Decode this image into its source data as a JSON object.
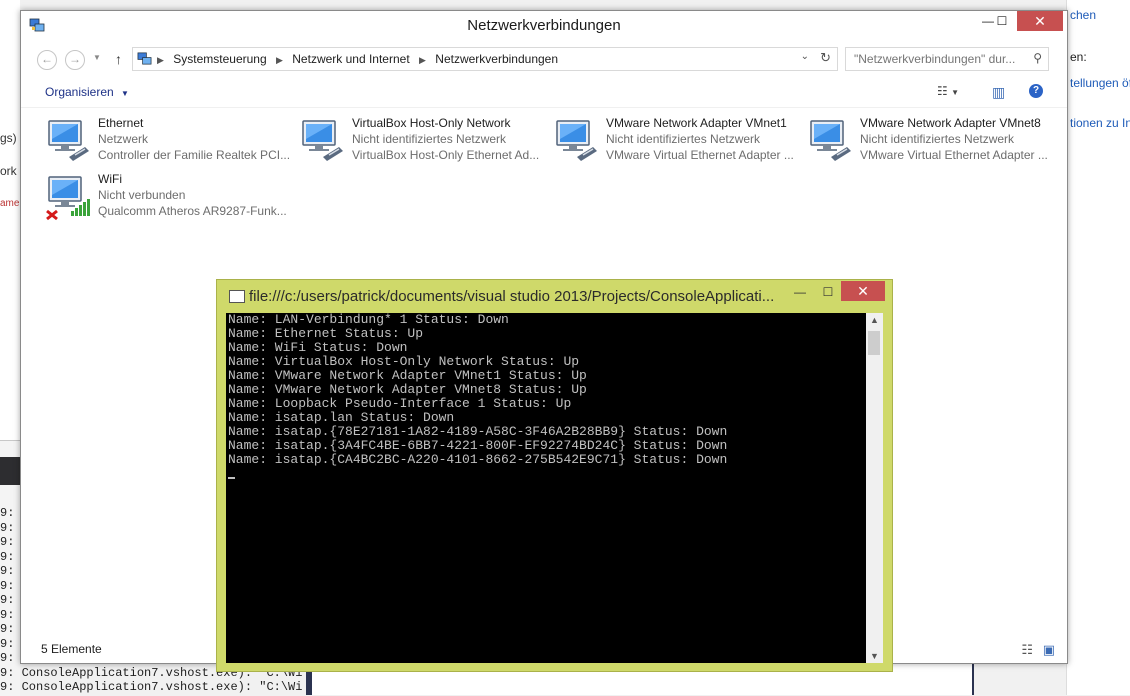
{
  "background": {
    "left_fragments": [
      "gs)",
      "ork",
      "ame"
    ],
    "right_links": [
      "chen",
      "en:",
      "tellungen öf",
      "tionen zu In"
    ],
    "console_lines": [
      "9:",
      "9:",
      "9:",
      "9:",
      "9:",
      "9:",
      "9:",
      "9:",
      "9:",
      "9:",
      "9:",
      "9: ConsoleApplication7.vshost.exe): \"C:\\Wi",
      "9: ConsoleApplication7.vshost.exe): \"C:\\Wi"
    ]
  },
  "explorer": {
    "title": "Netzwerkverbindungen",
    "window_controls": {
      "minimize": "—",
      "maximize": "☐",
      "close": "✕"
    },
    "breadcrumb": [
      "Systemsteuerung",
      "Netzwerk und Internet",
      "Netzwerkverbindungen"
    ],
    "search": {
      "placeholder": "\"Netzwerkverbindungen\" dur..."
    },
    "toolbar": {
      "organize": "Organisieren"
    },
    "items": [
      {
        "name": "Ethernet",
        "status": "Netzwerk",
        "adapter": "Controller der Familie Realtek PCI...",
        "type": "wired",
        "connected": true
      },
      {
        "name": "VirtualBox Host-Only Network",
        "status": "Nicht identifiziertes Netzwerk",
        "adapter": "VirtualBox Host-Only Ethernet Ad...",
        "type": "wired",
        "connected": true
      },
      {
        "name": "VMware Network Adapter VMnet1",
        "status": "Nicht identifiziertes Netzwerk",
        "adapter": "VMware Virtual Ethernet Adapter ...",
        "type": "wired",
        "connected": true
      },
      {
        "name": "VMware Network Adapter VMnet8",
        "status": "Nicht identifiziertes Netzwerk",
        "adapter": "VMware Virtual Ethernet Adapter ...",
        "type": "wired",
        "connected": true
      },
      {
        "name": "WiFi",
        "status": "Nicht verbunden",
        "adapter": "Qualcomm Atheros AR9287-Funk...",
        "type": "wireless",
        "connected": false
      }
    ],
    "status_count": "5 Elemente"
  },
  "console": {
    "title": "file:///c:/users/patrick/documents/visual studio 2013/Projects/ConsoleApplicati...",
    "window_controls": {
      "minimize": "—",
      "maximize": "☐",
      "close": "✕"
    },
    "lines": [
      "Name: LAN-Verbindung* 1 Status: Down",
      "Name: Ethernet Status: Up",
      "Name: WiFi Status: Down",
      "Name: VirtualBox Host-Only Network Status: Up",
      "Name: VMware Network Adapter VMnet1 Status: Up",
      "Name: VMware Network Adapter VMnet8 Status: Up",
      "Name: Loopback Pseudo-Interface 1 Status: Up",
      "Name: isatap.lan Status: Down",
      "Name: isatap.{78E27181-1A82-4189-A58C-3F46A2B28BB9} Status: Down",
      "Name: isatap.{3A4FC4BE-6BB7-4221-800F-EF92274BD24C} Status: Down",
      "Name: isatap.{CA4BC2BC-A220-4101-8662-275B542E9C71} Status: Down"
    ]
  },
  "colors": {
    "console_frame": "#cfd96a",
    "close_button": "#c75050",
    "link": "#1e3287"
  }
}
